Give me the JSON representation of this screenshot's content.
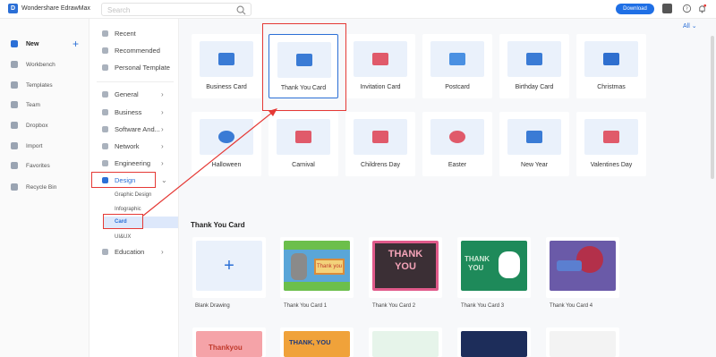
{
  "app": {
    "title": "Wondershare EdrawMax",
    "logo_letter": "D"
  },
  "search": {
    "placeholder": "Search"
  },
  "toolbar": {
    "download_label": "Download"
  },
  "sidebar": {
    "new_label": "New",
    "items": [
      "Workbench",
      "Templates",
      "Team",
      "Dropbox",
      "Import",
      "Favorites",
      "Recycle Bin"
    ]
  },
  "categories": {
    "top": [
      "Recent",
      "Recommended",
      "Personal Template"
    ],
    "groups": [
      "General",
      "Business",
      "Software And...",
      "Network",
      "Engineering",
      "Design",
      "Education"
    ],
    "design_sub": [
      "Graphic Design",
      "Infographic",
      "Card",
      "UI&UX"
    ]
  },
  "filter": {
    "all_label": "All"
  },
  "tiles": [
    "Business Card",
    "Thank You Card",
    "Invitation Card",
    "Postcard",
    "Birthday Card",
    "Christmas",
    "Halloween",
    "Carnival",
    "Childrens Day",
    "Easter",
    "New Year",
    "Valentines Day"
  ],
  "section": {
    "title": "Thank You Card"
  },
  "templates": {
    "blank_label": "Blank Drawing",
    "cards": [
      "Thank You Card 1",
      "Thank You Card 2",
      "Thank You Card 3",
      "Thank You Card 4"
    ],
    "card_texts": {
      "c1": "Thank you",
      "c2a": "THANK",
      "c2b": "YOU",
      "c3a": "THANK",
      "c3b": "YOU",
      "row2a": "THANK, YOU",
      "row2b": "Thankyou"
    }
  },
  "colors": {
    "accent": "#2b6fd6",
    "highlight": "#e53935"
  }
}
